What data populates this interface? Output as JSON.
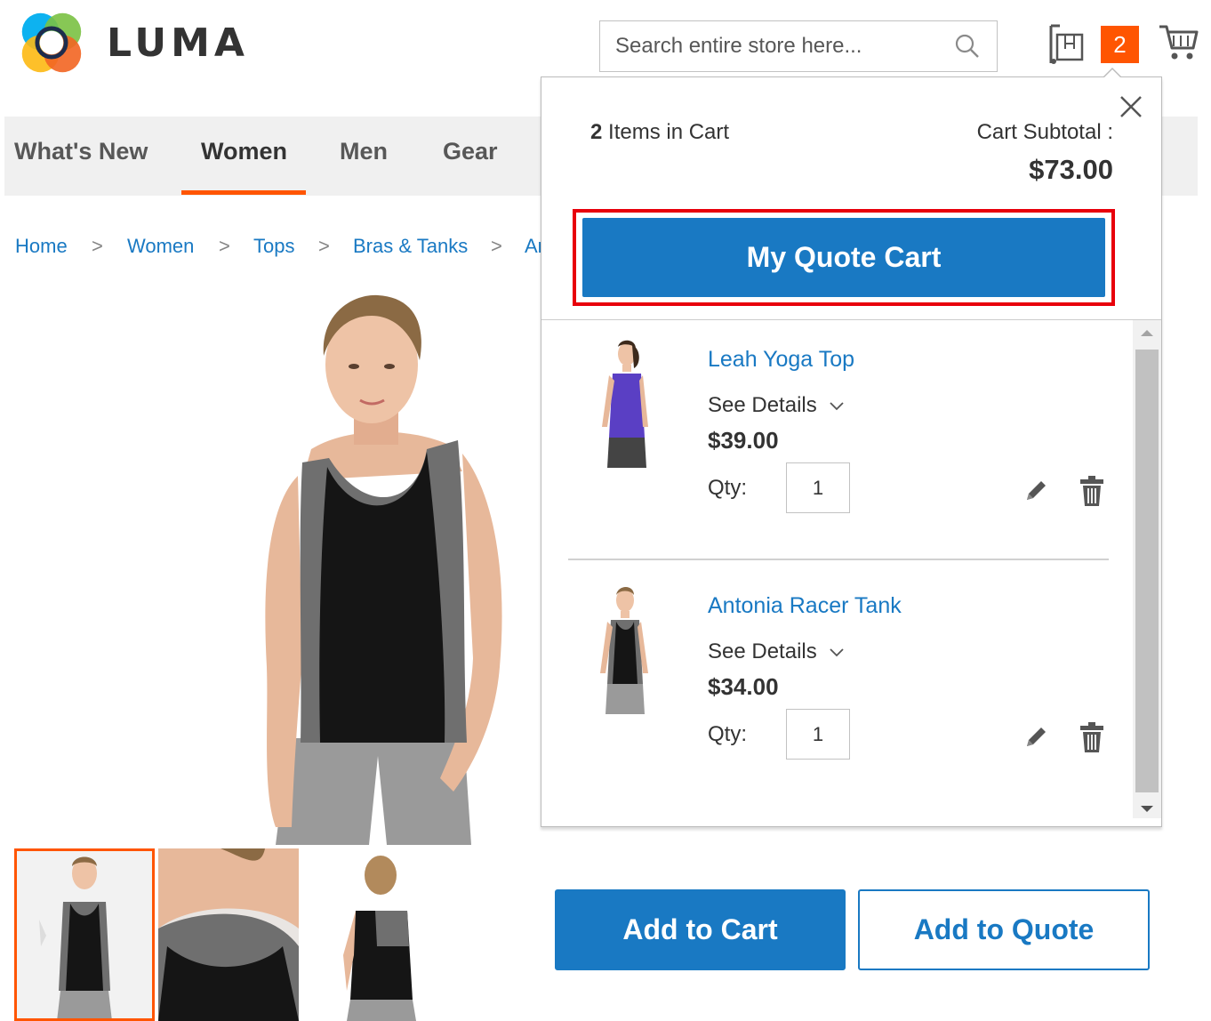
{
  "header": {
    "logo_text": "LUMA",
    "search": {
      "placeholder": "Search entire store here..."
    },
    "quote_badge_count": "2"
  },
  "nav": {
    "items": [
      {
        "label": "What's New"
      },
      {
        "label": "Women"
      },
      {
        "label": "Men"
      },
      {
        "label": "Gear"
      }
    ],
    "active_index": 1
  },
  "breadcrumbs": {
    "items": [
      "Home",
      "Women",
      "Tops",
      "Bras & Tanks",
      "Ar"
    ],
    "separator": ">"
  },
  "minicart": {
    "items_count": "2",
    "items_label": "Items in Cart",
    "subtotal_label": "Cart Subtotal :",
    "subtotal_value": "$73.00",
    "quote_button_label": "My Quote Cart",
    "items": [
      {
        "name": "Leah Yoga Top",
        "details_label": "See Details",
        "price": "$39.00",
        "qty_label": "Qty:",
        "qty": "1",
        "top_color": "#5a3fc4"
      },
      {
        "name": "Antonia Racer Tank",
        "details_label": "See Details",
        "price": "$34.00",
        "qty_label": "Qty:",
        "qty": "1",
        "top_color": "#1c1c1c"
      }
    ]
  },
  "product": {
    "add_to_cart_label": "Add to Cart",
    "add_to_quote_label": "Add to Quote"
  },
  "colors": {
    "brand_blue": "#1979c3",
    "accent_orange": "#ff5501",
    "highlight_red": "#e8000b"
  }
}
